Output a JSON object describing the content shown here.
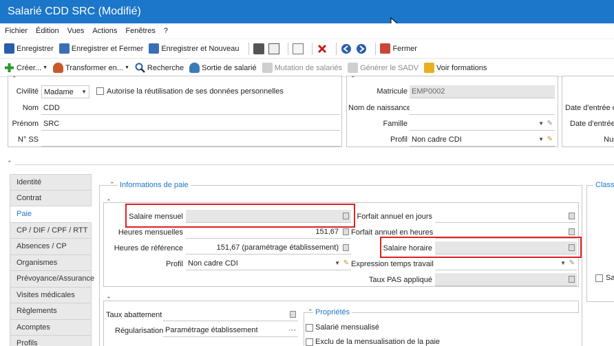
{
  "window": {
    "title": "Salarié CDD SRC (Modifié)"
  },
  "menu": [
    "Fichier",
    "Édition",
    "Vues",
    "Actions",
    "Fenêtres",
    "?"
  ],
  "toolbar1": {
    "save": "Enregistrer",
    "save_close": "Enregistrer et Fermer",
    "save_new": "Enregistrer et Nouveau",
    "close": "Fermer"
  },
  "toolbar2": {
    "create": "Créer...",
    "transform": "Transformer en...",
    "search": "Recherche",
    "exit": "Sortie de salarié",
    "mutation": "Mutation de salariés",
    "sadv": "Générer le SADV",
    "trainings": "Voir formations"
  },
  "identity": {
    "civilite_label": "Civilité",
    "civilite_value": "Madame",
    "autorise_label": "Autorise la réutilisation de ses données personnelles",
    "nom_label": "Nom",
    "nom_value": "CDD",
    "prenom_label": "Prénom",
    "prenom_value": "SRC",
    "nss_label": "N° SS",
    "nss_value": ""
  },
  "employee": {
    "matricule_label": "Matricule",
    "matricule_value": "EMP0002",
    "nom_naissance_label": "Nom de naissance",
    "nom_naissance_value": "",
    "famille_label": "Famille",
    "famille_value": "",
    "profil_label": "Profil",
    "profil_value": "Non cadre CDI"
  },
  "dates": {
    "date_entree_1": "Date d'entrée d",
    "date_entree_2": "Date d'entrée",
    "num": "Num"
  },
  "tabs": [
    "Identité",
    "Contrat",
    "Paie",
    "CP / DIF / CPF / RTT",
    "Absences / CP",
    "Organismes",
    "Prévoyance/Assurance",
    "Visites médicales",
    "Règlements",
    "Acomptes",
    "Profils"
  ],
  "active_tab": "Paie",
  "pay": {
    "section_title": "Informations de paie",
    "salaire_mensuel_label": "Salaire mensuel",
    "salaire_mensuel_value": "",
    "heures_mensuelles_label": "Heures mensuelles",
    "heures_mensuelles_value": "151,67",
    "heures_reference_label": "Heures de référence",
    "heures_reference_value": "151,67 (paramétrage établissement)",
    "profil_label": "Profil",
    "profil_value": "Non cadre CDI",
    "forfait_jours_label": "Forfait annuel en jours",
    "forfait_heures_label": "Forfait annuel en heures",
    "salaire_horaire_label": "Salaire horaire",
    "expression_label": "Expression temps travail",
    "taux_pas_label": "Taux PAS appliqué"
  },
  "lower": {
    "taux_abattement_label": "Taux abattement",
    "regularisation_label": "Régularisation",
    "regularisation_value": "Paramétrage établissement",
    "props_title": "Propriétés",
    "salarie_mensualise": "Salarié mensualisé",
    "exclu_mensualisation": "Exclu de la mensualisation de la paie"
  },
  "right_panel": {
    "title": "Classe",
    "checkbox_label": "Sa"
  },
  "highlight_color": "#e02020",
  "accent_color": "#1c76c9"
}
